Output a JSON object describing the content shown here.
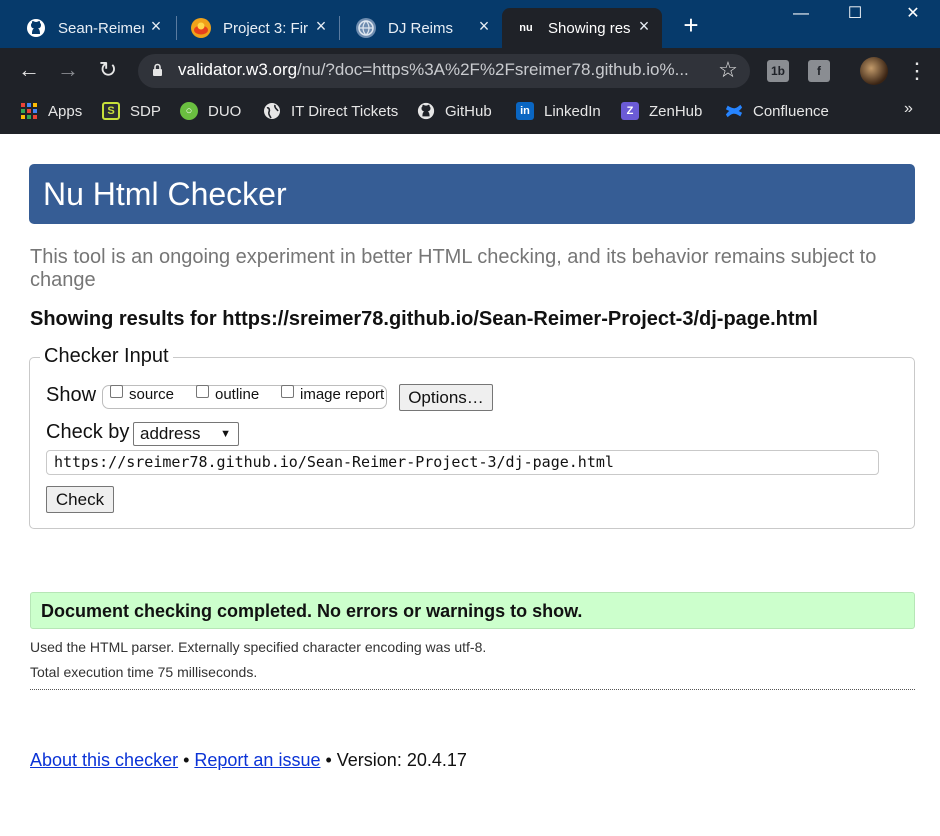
{
  "browser": {
    "tabs": [
      {
        "title": "Sean-Reimer",
        "icon": "github-icon"
      },
      {
        "title": "Project 3: Fir",
        "icon": "project-icon"
      },
      {
        "title": "DJ Reims",
        "icon": "globe-icon"
      },
      {
        "title": "Showing res",
        "icon": "nu-icon",
        "icon_text": "nu",
        "active": true
      }
    ],
    "address": {
      "host": "validator.w3.org",
      "path": "/nu/?doc=https%3A%2F%2Fsreimer78.github.io%..."
    },
    "extensions": {
      "ext1": "1b",
      "ext2": "f"
    },
    "bookmarks": [
      {
        "label": "Apps",
        "icon": "apps-grid-icon"
      },
      {
        "label": "SDP",
        "icon": "sdp-icon"
      },
      {
        "label": "DUO",
        "icon": "duo-icon"
      },
      {
        "label": "IT Direct Tickets",
        "icon": "globe-icon"
      },
      {
        "label": "GitHub",
        "icon": "github-icon"
      },
      {
        "label": "LinkedIn",
        "icon": "linkedin-icon",
        "icon_text": "in"
      },
      {
        "label": "ZenHub",
        "icon": "zenhub-icon",
        "icon_text": "Z"
      },
      {
        "label": "Confluence",
        "icon": "confluence-icon"
      }
    ],
    "bookmarks_more": "»"
  },
  "checker": {
    "title": "Nu Html Checker",
    "intro": "This tool is an ongoing experiment in better HTML checking, and its behavior remains subject to change",
    "results_for": "Showing results for https://sreimer78.github.io/Sean-Reimer-Project-3/dj-page.html",
    "input": {
      "legend": "Checker Input",
      "show_label": "Show",
      "checkboxes": [
        "source",
        "outline",
        "image report"
      ],
      "options_button": "Options…",
      "check_by_label": "Check by",
      "check_by_value": "address",
      "url_value": "https://sreimer78.github.io/Sean-Reimer-Project-3/dj-page.html",
      "check_button": "Check"
    },
    "result": {
      "message": "Document checking completed. No errors or warnings to show.",
      "parser_note": "Used the HTML parser. Externally specified character encoding was utf-8.",
      "execution_time": "Total execution time 75 milliseconds."
    },
    "footer": {
      "about_link": "About this checker",
      "sep1": " • ",
      "report_link": "Report an issue",
      "sep2": " • ",
      "version": "Version: 20.4.17"
    }
  },
  "colors": {
    "header_blue": "#365d95",
    "success_green": "#ccffcc",
    "tabstrip": "#063a6b",
    "toolbar": "#1f2228"
  }
}
